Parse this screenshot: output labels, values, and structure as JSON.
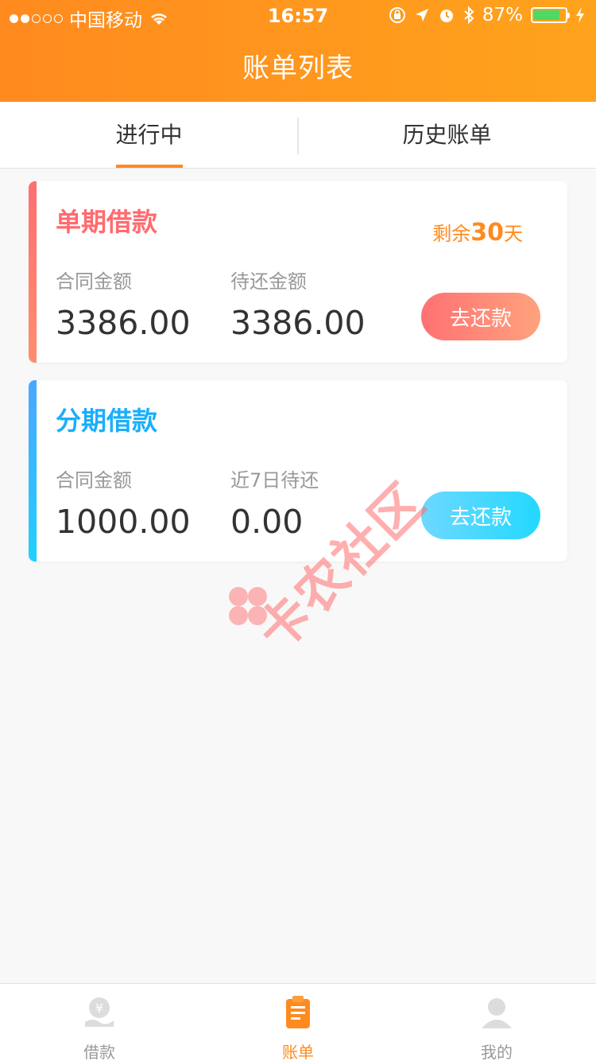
{
  "status_bar": {
    "carrier": "中国移动",
    "time": "16:57",
    "battery": "87%",
    "battery_level": 0.87
  },
  "nav": {
    "title": "账单列表"
  },
  "tabs": [
    {
      "label": "进行中",
      "active": true
    },
    {
      "label": "历史账单",
      "active": false
    }
  ],
  "bills": [
    {
      "title": "单期借款",
      "remain_prefix": "剩余",
      "remain_num": "30",
      "remain_suffix": "天",
      "label1": "合同金额",
      "amount1": "3386.00",
      "label2": "待还金额",
      "amount2": "3386.00",
      "button": "去还款"
    },
    {
      "title": "分期借款",
      "label1": "合同金额",
      "amount1": "1000.00",
      "label2": "近7日待还",
      "amount2": "0.00",
      "button": "去还款"
    }
  ],
  "watermark": "卡农社区",
  "tabbar": [
    {
      "label": "借款",
      "icon": "loan-hand-yen-icon",
      "active": false
    },
    {
      "label": "账单",
      "icon": "bill-clipboard-icon",
      "active": true
    },
    {
      "label": "我的",
      "icon": "user-profile-icon",
      "active": false
    }
  ],
  "colors": {
    "header_orange": "#ff8a1f",
    "single_red": "#ff6b6f",
    "installment_blue": "#1aaefc",
    "tab_active": "#ff8a1f"
  }
}
